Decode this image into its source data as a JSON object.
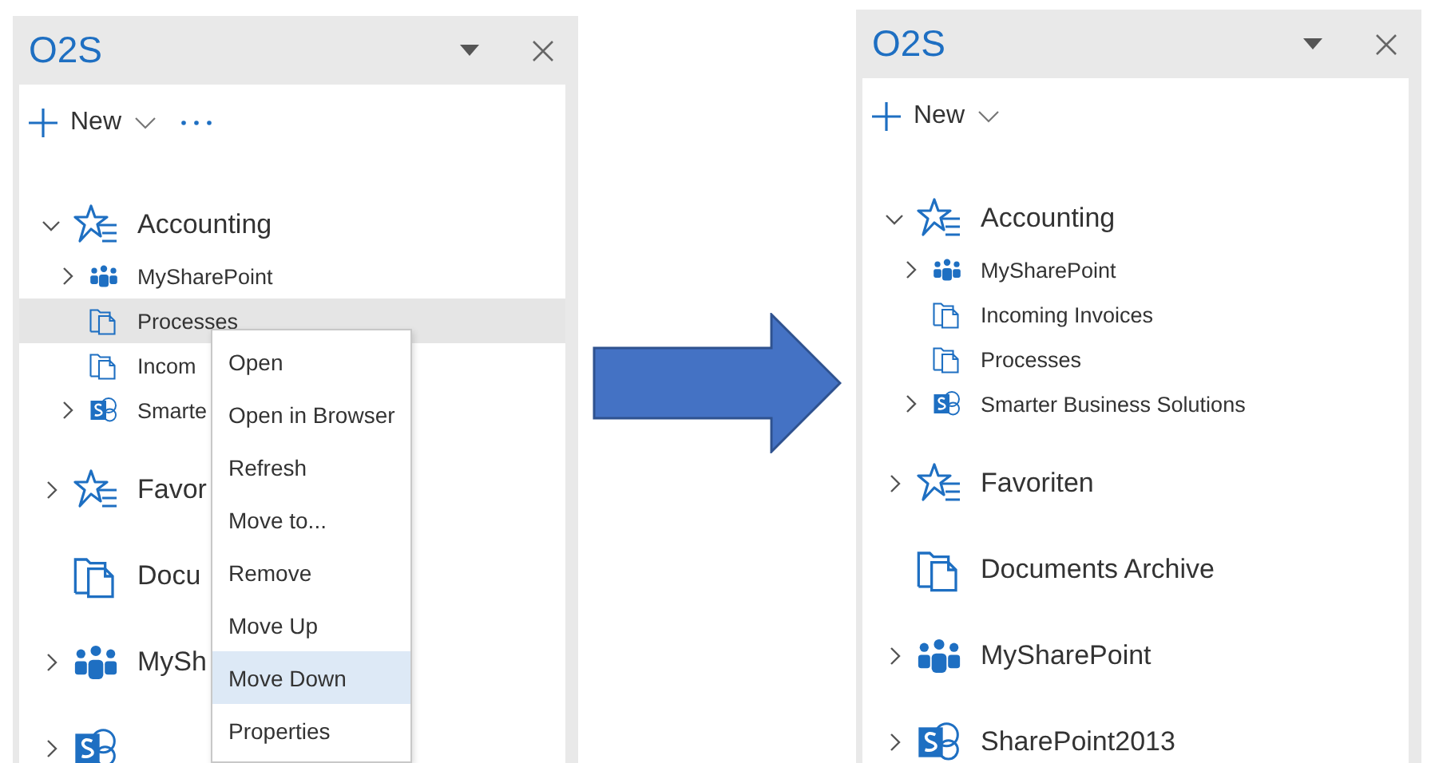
{
  "panels": [
    {
      "title": "O2S",
      "toolbar": {
        "new_label": "New",
        "more_button": true
      },
      "tree": [
        {
          "label": "Accounting",
          "kind": "favorites",
          "expanded": true,
          "selected": false,
          "children": [
            {
              "label": "MySharePoint",
              "kind": "team",
              "expanded": false,
              "selected": false
            },
            {
              "label": "Processes",
              "kind": "library",
              "selected": true
            },
            {
              "label": "Incom",
              "kind": "library",
              "selected": false
            },
            {
              "label": "Smarte",
              "kind": "sharepoint",
              "expanded": false,
              "selected": false
            }
          ]
        },
        {
          "label": "Favor",
          "kind": "favorites",
          "expanded": false,
          "selected": false
        },
        {
          "label": "Docu",
          "kind": "library",
          "selected": false
        },
        {
          "label": "MySh",
          "kind": "team",
          "expanded": false,
          "selected": false
        },
        {
          "kind": "sharepoint",
          "expanded": false,
          "selected": false
        }
      ],
      "context_menu": [
        {
          "label": "Open",
          "selected": false
        },
        {
          "label": "Open in Browser",
          "selected": false
        },
        {
          "label": "Refresh",
          "selected": false
        },
        {
          "label": "Move to...",
          "selected": false
        },
        {
          "label": "Remove",
          "selected": false
        },
        {
          "label": "Move Up",
          "selected": false
        },
        {
          "label": "Move Down",
          "selected": true
        },
        {
          "label": "Properties",
          "selected": false
        }
      ]
    },
    {
      "title": "O2S",
      "toolbar": {
        "new_label": "New"
      },
      "tree": [
        {
          "label": "Accounting",
          "kind": "favorites",
          "expanded": true,
          "selected": false,
          "children": [
            {
              "label": "MySharePoint",
              "kind": "team",
              "expanded": false,
              "selected": false
            },
            {
              "label": "Incoming Invoices",
              "kind": "library",
              "selected": false
            },
            {
              "label": "Processes",
              "kind": "library",
              "selected": false
            },
            {
              "label": "Smarter Business Solutions",
              "kind": "sharepoint",
              "expanded": false,
              "selected": false
            }
          ]
        },
        {
          "label": "Favoriten",
          "kind": "favorites",
          "expanded": false,
          "selected": false
        },
        {
          "label": "Documents Archive",
          "kind": "library",
          "selected": false
        },
        {
          "label": "MySharePoint",
          "kind": "team",
          "expanded": false,
          "selected": false
        },
        {
          "label": "SharePoint2013",
          "kind": "sharepoint",
          "expanded": false,
          "selected": false
        }
      ]
    }
  ]
}
